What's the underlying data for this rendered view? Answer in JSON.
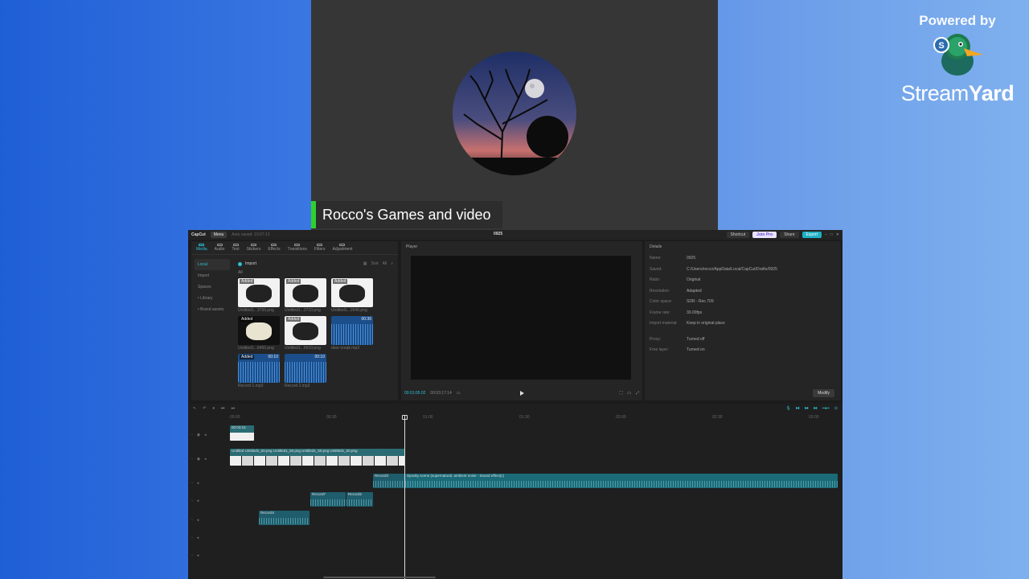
{
  "branding": {
    "powered_by": "Powered by",
    "name_regular": "Stream",
    "name_bold": "Yard"
  },
  "stage": {
    "name_tag": "Rocco's Games and video"
  },
  "capcut": {
    "titlebar": {
      "app_name": "CapCut",
      "menu": "Menu",
      "autosave": "Auto saved: 10:07:13",
      "project_title": "0925",
      "shortcut": "Shortcut",
      "join_pro": "Join Pro",
      "share": "Share",
      "export": "Export"
    },
    "media_tools": [
      "Media",
      "Audio",
      "Text",
      "Stickers",
      "Effects",
      "Transitions",
      "Filters",
      "Adjustment"
    ],
    "media_side": [
      "Local",
      "Import",
      "Spaces",
      "• Library",
      "• Brand assets"
    ],
    "import_label": "Import",
    "filter_labels": [
      "Sort",
      "All"
    ],
    "all_label": "All",
    "media_items": [
      {
        "type": "white",
        "badge": "Added",
        "duration": "",
        "name": "Untitled1...3750.png"
      },
      {
        "type": "white",
        "badge": "Added",
        "duration": "",
        "name": "Untitled1...2710.png"
      },
      {
        "type": "white",
        "badge": "Added",
        "duration": "",
        "name": "Untitled1...2640.png"
      },
      {
        "type": "dark",
        "badge": "Added",
        "duration": "",
        "name": "Untitled1...6450.png"
      },
      {
        "type": "white",
        "badge": "Added",
        "duration": "",
        "name": "Untitled1...6610.png"
      },
      {
        "type": "audio",
        "badge": "",
        "duration": "00:36",
        "name": "door-creak.mp3"
      },
      {
        "type": "audio",
        "badge": "Added",
        "duration": "00:10",
        "name": "Record 1.mp3"
      },
      {
        "type": "audio",
        "badge": "",
        "duration": "00:10",
        "name": "Record 2.mp3"
      }
    ],
    "player": {
      "title": "Player",
      "current_time": "00:01:05:02",
      "total_time": "00:03:17:14"
    },
    "details": {
      "title": "Details",
      "rows": [
        {
          "key": "Name:",
          "value": "0925"
        },
        {
          "key": "Saved:",
          "value": "C:/Users/rocco/AppData/Local/CapCut/Drafts/0925"
        },
        {
          "key": "Ratio:",
          "value": "Original"
        },
        {
          "key": "Resolution:",
          "value": "Adapted"
        },
        {
          "key": "Color space:",
          "value": "SDR - Rec.709"
        },
        {
          "key": "Frame rate:",
          "value": "30.00fps"
        },
        {
          "key": "Import material:",
          "value": "Keep in original place"
        },
        {
          "key": "Proxy:",
          "value": "Turned off"
        },
        {
          "key": "Free layer:",
          "value": "Turned on"
        }
      ],
      "modify": "Modify"
    },
    "timeline": {
      "ruler": [
        "00:00",
        "00:30",
        "01:00",
        "01:30",
        "02:00",
        "02:30",
        "03:00"
      ],
      "clips": {
        "video_top": "00:03:16",
        "video_strip": [
          "Untitled",
          "Untitled1_50.png",
          "Untitled1_50.png",
          "Untitled1_50.png",
          "Untitled1_50.png"
        ],
        "audio_long": "Spooky scene (supernatural, ambient noise - Sound effect(c)",
        "record3": "Record3",
        "record7": "Record7",
        "record2": "Record2",
        "record4": "Record4"
      }
    }
  }
}
